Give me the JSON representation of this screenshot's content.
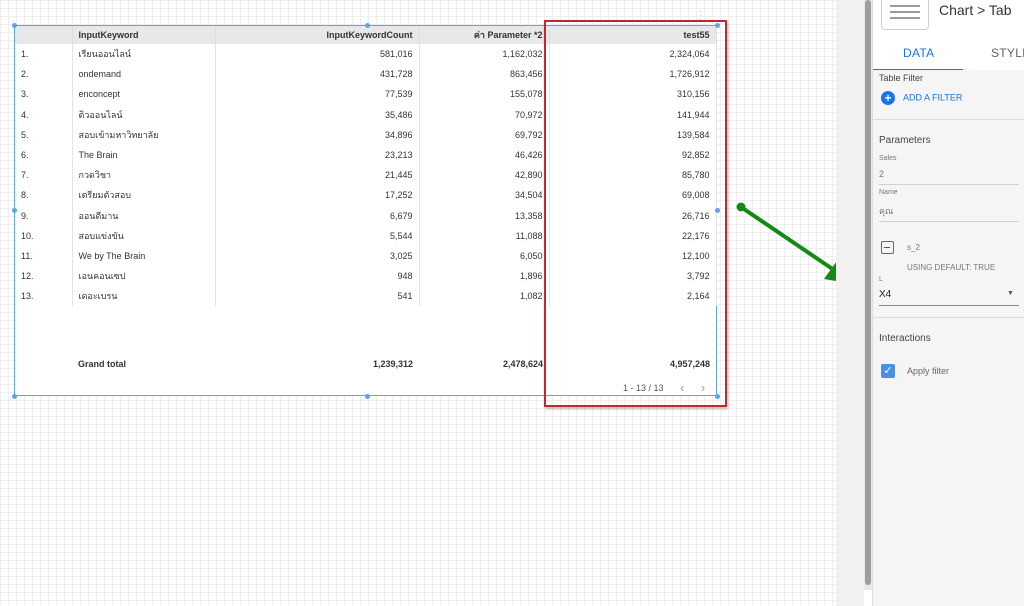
{
  "table": {
    "columns": [
      "",
      "InputKeyword",
      "InputKeywordCount",
      "ค่า Parameter *2",
      "test55"
    ],
    "rows": [
      [
        "1.",
        "เรียนออนไลน์",
        "581,016",
        "1,162,032",
        "2,324,064"
      ],
      [
        "2.",
        "ondemand",
        "431,728",
        "863,456",
        "1,726,912"
      ],
      [
        "3.",
        "enconcept",
        "77,539",
        "155,078",
        "310,156"
      ],
      [
        "4.",
        "ติวออนไลน์",
        "35,486",
        "70,972",
        "141,944"
      ],
      [
        "5.",
        "สอบเข้ามหาวิทยาลัย",
        "34,896",
        "69,792",
        "139,584"
      ],
      [
        "6.",
        "The Brain",
        "23,213",
        "46,426",
        "92,852"
      ],
      [
        "7.",
        "กวดวิชา",
        "21,445",
        "42,890",
        "85,780"
      ],
      [
        "8.",
        "เตรียมตัวสอบ",
        "17,252",
        "34,504",
        "69,008"
      ],
      [
        "9.",
        "ออนดีมาน",
        "6,679",
        "13,358",
        "26,716"
      ],
      [
        "10.",
        "สอบแข่งขัน",
        "5,544",
        "11,088",
        "22,176"
      ],
      [
        "11.",
        "We by The Brain",
        "3,025",
        "6,050",
        "12,100"
      ],
      [
        "12.",
        "เอนคอนเซป",
        "948",
        "1,896",
        "3,792"
      ],
      [
        "13.",
        "เดอะเบรน",
        "541",
        "1,082",
        "2,164"
      ]
    ],
    "grand_total": {
      "label": "Grand total",
      "values": [
        "1,239,312",
        "2,478,624",
        "4,957,248"
      ]
    },
    "pagination": "1 - 13 / 13",
    "prev_icon": "chevron-left-icon",
    "next_icon": "chevron-right-icon"
  },
  "panel": {
    "breadcrumb": "Chart > Tab",
    "tabs": [
      "DATA",
      "STYLE"
    ],
    "table_filter": {
      "title": "Table Filter",
      "add_label": "ADD A FILTER"
    },
    "parameters": {
      "title": "Parameters",
      "sales_label": "Sales",
      "sales_value": "2",
      "name_label": "Name",
      "name_value": "คุณ",
      "s2_label": "s_2",
      "s2_default": "USING DEFAULT: TRUE",
      "l_label": "L",
      "l_value": "X4"
    },
    "interactions": {
      "title": "Interactions",
      "apply_filter": "Apply filter",
      "apply_filter_checked": true
    }
  },
  "colors": {
    "accent": "#1a73e8",
    "selection": "#5ea4e6",
    "highlight_box": "#c0282d",
    "arrow": "#138a13"
  }
}
